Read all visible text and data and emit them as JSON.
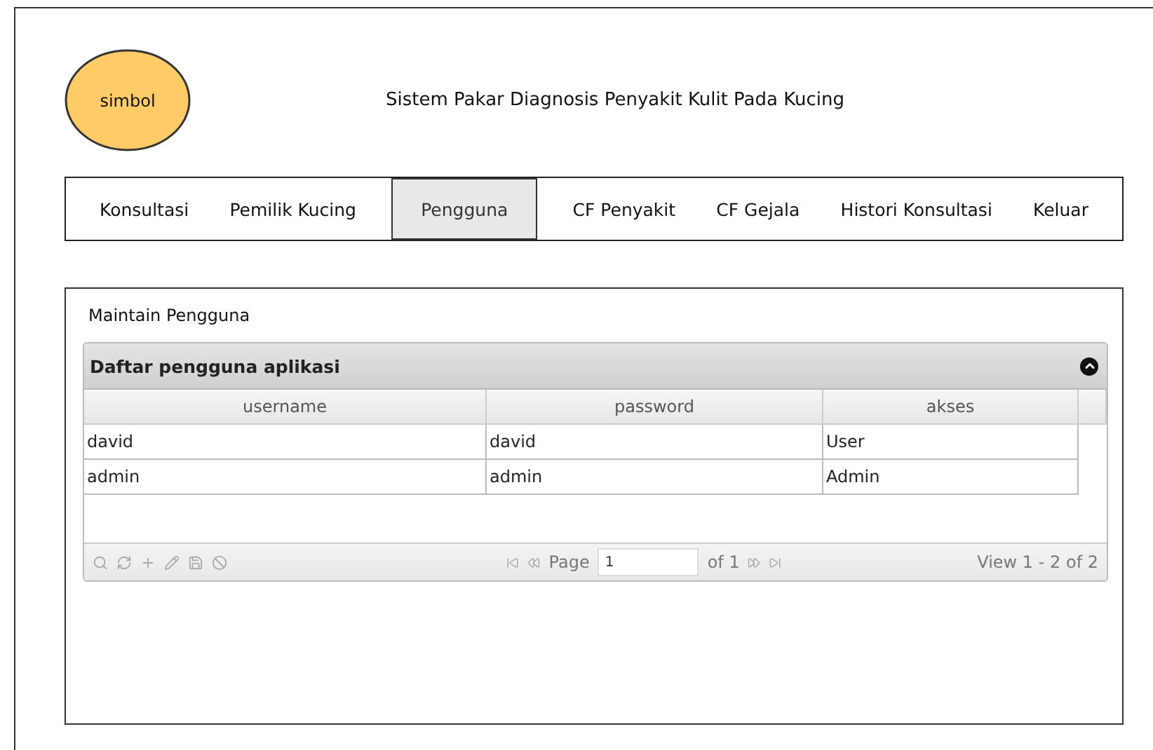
{
  "logo": {
    "text": "simbol"
  },
  "app_title": "Sistem Pakar Diagnosis Penyakit Kulit Pada Kucing",
  "nav": [
    {
      "label": "Konsultasi",
      "selected": false
    },
    {
      "label": "Pemilik Kucing",
      "selected": false
    },
    {
      "label": "Pengguna",
      "selected": true
    },
    {
      "label": "CF Penyakit",
      "selected": false
    },
    {
      "label": "CF Gejala",
      "selected": false
    },
    {
      "label": "Histori Konsultasi",
      "selected": false
    },
    {
      "label": "Keluar",
      "selected": false
    }
  ],
  "section_title": "Maintain Pengguna",
  "grid": {
    "title": "Daftar pengguna aplikasi",
    "columns": [
      "username",
      "password",
      "akses"
    ],
    "rows": [
      [
        "david",
        "david",
        "User"
      ],
      [
        "admin",
        "admin",
        "Admin"
      ]
    ],
    "pager": {
      "page_label": "Page",
      "page_value": "1",
      "of": "of 1",
      "view": "View 1 - 2 of 2"
    }
  }
}
